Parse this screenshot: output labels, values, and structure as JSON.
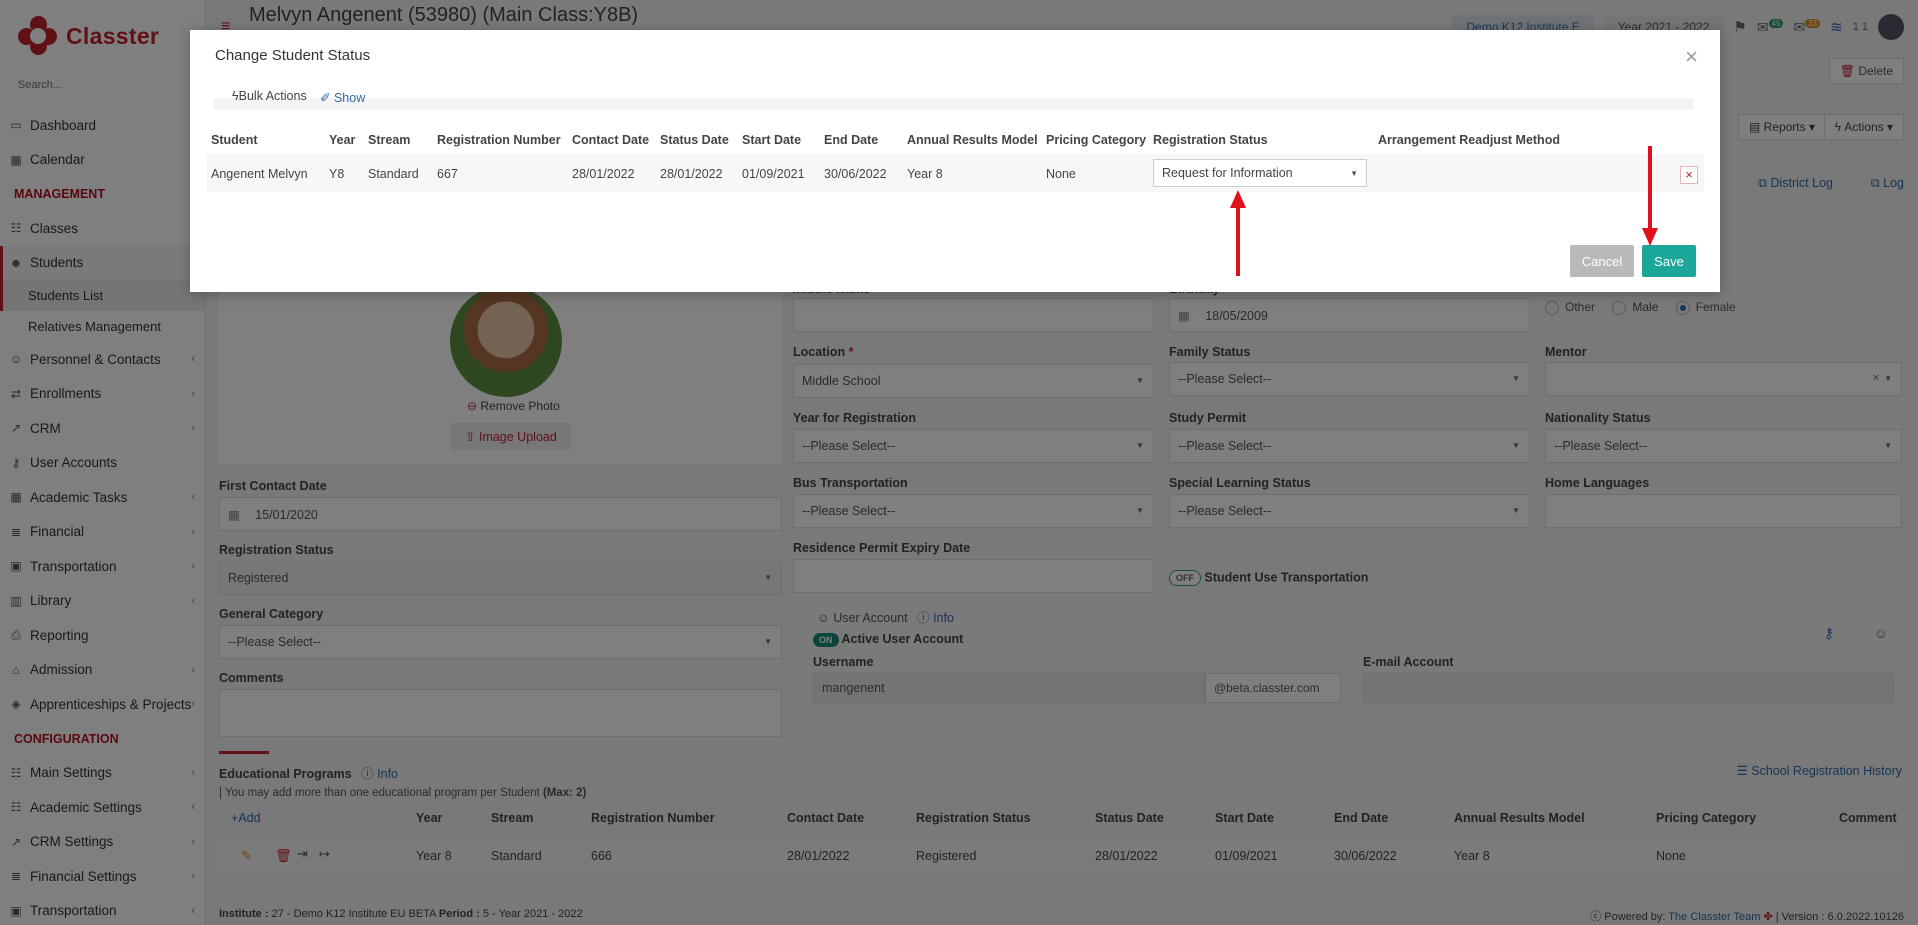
{
  "app": {
    "logo_text": "Classter",
    "brand_color": "#c0222c"
  },
  "sidebar": {
    "search_placeholder": "Search...",
    "items": [
      {
        "label": "Dashboard",
        "icon": "dashboard-icon"
      },
      {
        "label": "Calendar",
        "icon": "calendar-icon"
      }
    ],
    "management_header": "MANAGEMENT",
    "management": [
      {
        "label": "Classes",
        "icon": "classes-icon"
      },
      {
        "label": "Students",
        "icon": "students-icon"
      }
    ],
    "students_sub": [
      "Students List",
      "Relatives Management"
    ],
    "management_more": [
      {
        "label": "Personnel & Contacts",
        "icon": "personnel-icon"
      },
      {
        "label": "Enrollments",
        "icon": "enrollments-icon"
      },
      {
        "label": "CRM",
        "icon": "crm-icon"
      },
      {
        "label": "User Accounts",
        "icon": "key-icon"
      },
      {
        "label": "Academic Tasks",
        "icon": "grid-icon"
      },
      {
        "label": "Financial",
        "icon": "financial-icon"
      },
      {
        "label": "Transportation",
        "icon": "bus-icon"
      },
      {
        "label": "Library",
        "icon": "library-icon"
      },
      {
        "label": "Reporting",
        "icon": "print-icon"
      },
      {
        "label": "Admission",
        "icon": "bank-icon"
      },
      {
        "label": "Apprenticeships & Projects",
        "icon": "cube-icon"
      }
    ],
    "configuration_header": "CONFIGURATION",
    "configuration": [
      {
        "label": "Main Settings",
        "icon": "settings-icon"
      },
      {
        "label": "Academic Settings",
        "icon": "settings-icon"
      },
      {
        "label": "CRM Settings",
        "icon": "crm-icon"
      },
      {
        "label": "Financial Settings",
        "icon": "financial-icon"
      },
      {
        "label": "Transportation",
        "icon": "bus-icon"
      }
    ]
  },
  "header": {
    "page_title": "Melvyn Angenent (53980) (Main Class:Y8B)",
    "institute_pill": "Demo K12 Institute E",
    "year_pill": "Year 2021 - 2022",
    "badge_messages": "45",
    "badge_mail": "23",
    "user_short": "1 1",
    "delete_label": "Delete",
    "reports_label": "Reports",
    "actions_label": "Actions",
    "district_log": "District Log",
    "log": "Log"
  },
  "form": {
    "remove_photo": "Remove Photo",
    "image_upload": "Image Upload",
    "first_contact_date_label": "First Contact Date",
    "first_contact_date": "15/01/2020",
    "registration_status_label": "Registration Status",
    "registration_status": "Registered",
    "general_category_label": "General Category",
    "general_category": "--Please Select--",
    "comments_label": "Comments",
    "middle_name_label": "Middle Name",
    "birthday_label": "Birthday",
    "birthday": "18/05/2009",
    "gender_options": [
      "Other",
      "Male",
      "Female"
    ],
    "gender_selected": "Female",
    "location_label": "Location",
    "location_required": "*",
    "location": "Middle School",
    "family_status_label": "Family Status",
    "family_status": "--Please Select--",
    "mentor_label": "Mentor",
    "year_reg_label": "Year for Registration",
    "year_reg": "--Please Select--",
    "study_permit_label": "Study Permit",
    "study_permit": "--Please Select--",
    "nationality_status_label": "Nationality Status",
    "nationality_status": "--Please Select--",
    "bus_label": "Bus Transportation",
    "bus": "--Please Select--",
    "special_learning_label": "Special Learning Status",
    "special_learning": "--Please Select--",
    "home_languages_label": "Home Languages",
    "residence_permit_label": "Residence Permit Expiry Date",
    "student_use_transport_toggle": "OFF",
    "student_use_transport_label": "Student Use Transportation",
    "user_account_label": "User Account",
    "info_label": "Info",
    "active_toggle": "ON",
    "active_user_label": "Active User Account",
    "username_label": "Username",
    "username": "mangenent",
    "domain": "@beta.classter.com",
    "email_label": "E-mail Account"
  },
  "programs": {
    "title": "Educational Programs",
    "info": "Info",
    "history_link": "School Registration History",
    "note": "| You may add more than one educational program per Student",
    "note_max": "(Max: 2)",
    "add_label": "Add",
    "headers": [
      "Year",
      "Stream",
      "Registration Number",
      "Contact Date",
      "Registration Status",
      "Status Date",
      "Start Date",
      "End Date",
      "Annual Results Model",
      "Pricing Category",
      "Comment"
    ],
    "row": [
      "Year 8",
      "Standard",
      "666",
      "28/01/2022",
      "Registered",
      "28/01/2022",
      "01/09/2021",
      "30/06/2022",
      "Year 8",
      "None",
      ""
    ]
  },
  "footer": {
    "institute_label": "Institute :",
    "institute": "27 - Demo K12 Institute EU BETA",
    "period_label": "Period :",
    "period": "5 - Year 2021 - 2022",
    "powered_label": "Powered by:",
    "powered_team": "The Classter Team",
    "version": "| Version : 6.0.2022.10126"
  },
  "modal": {
    "title": "Change Student Status",
    "bulk_actions": "Bulk Actions",
    "show": "Show",
    "headers": [
      "Student",
      "Year",
      "Stream",
      "Registration Number",
      "Contact Date",
      "Status Date",
      "Start Date",
      "End Date",
      "Annual Results Model",
      "Pricing Category",
      "Registration Status",
      "Arrangement Readjust Method"
    ],
    "row": [
      "Angenent Melvyn",
      "Y8",
      "Standard",
      "667",
      "28/01/2022",
      "28/01/2022",
      "01/09/2021",
      "30/06/2022",
      "Year 8",
      "None"
    ],
    "status_value": "Request for Information",
    "cancel": "Cancel",
    "save": "Save",
    "save_color": "#1aa79a",
    "annotation_color": "#e0101c"
  }
}
